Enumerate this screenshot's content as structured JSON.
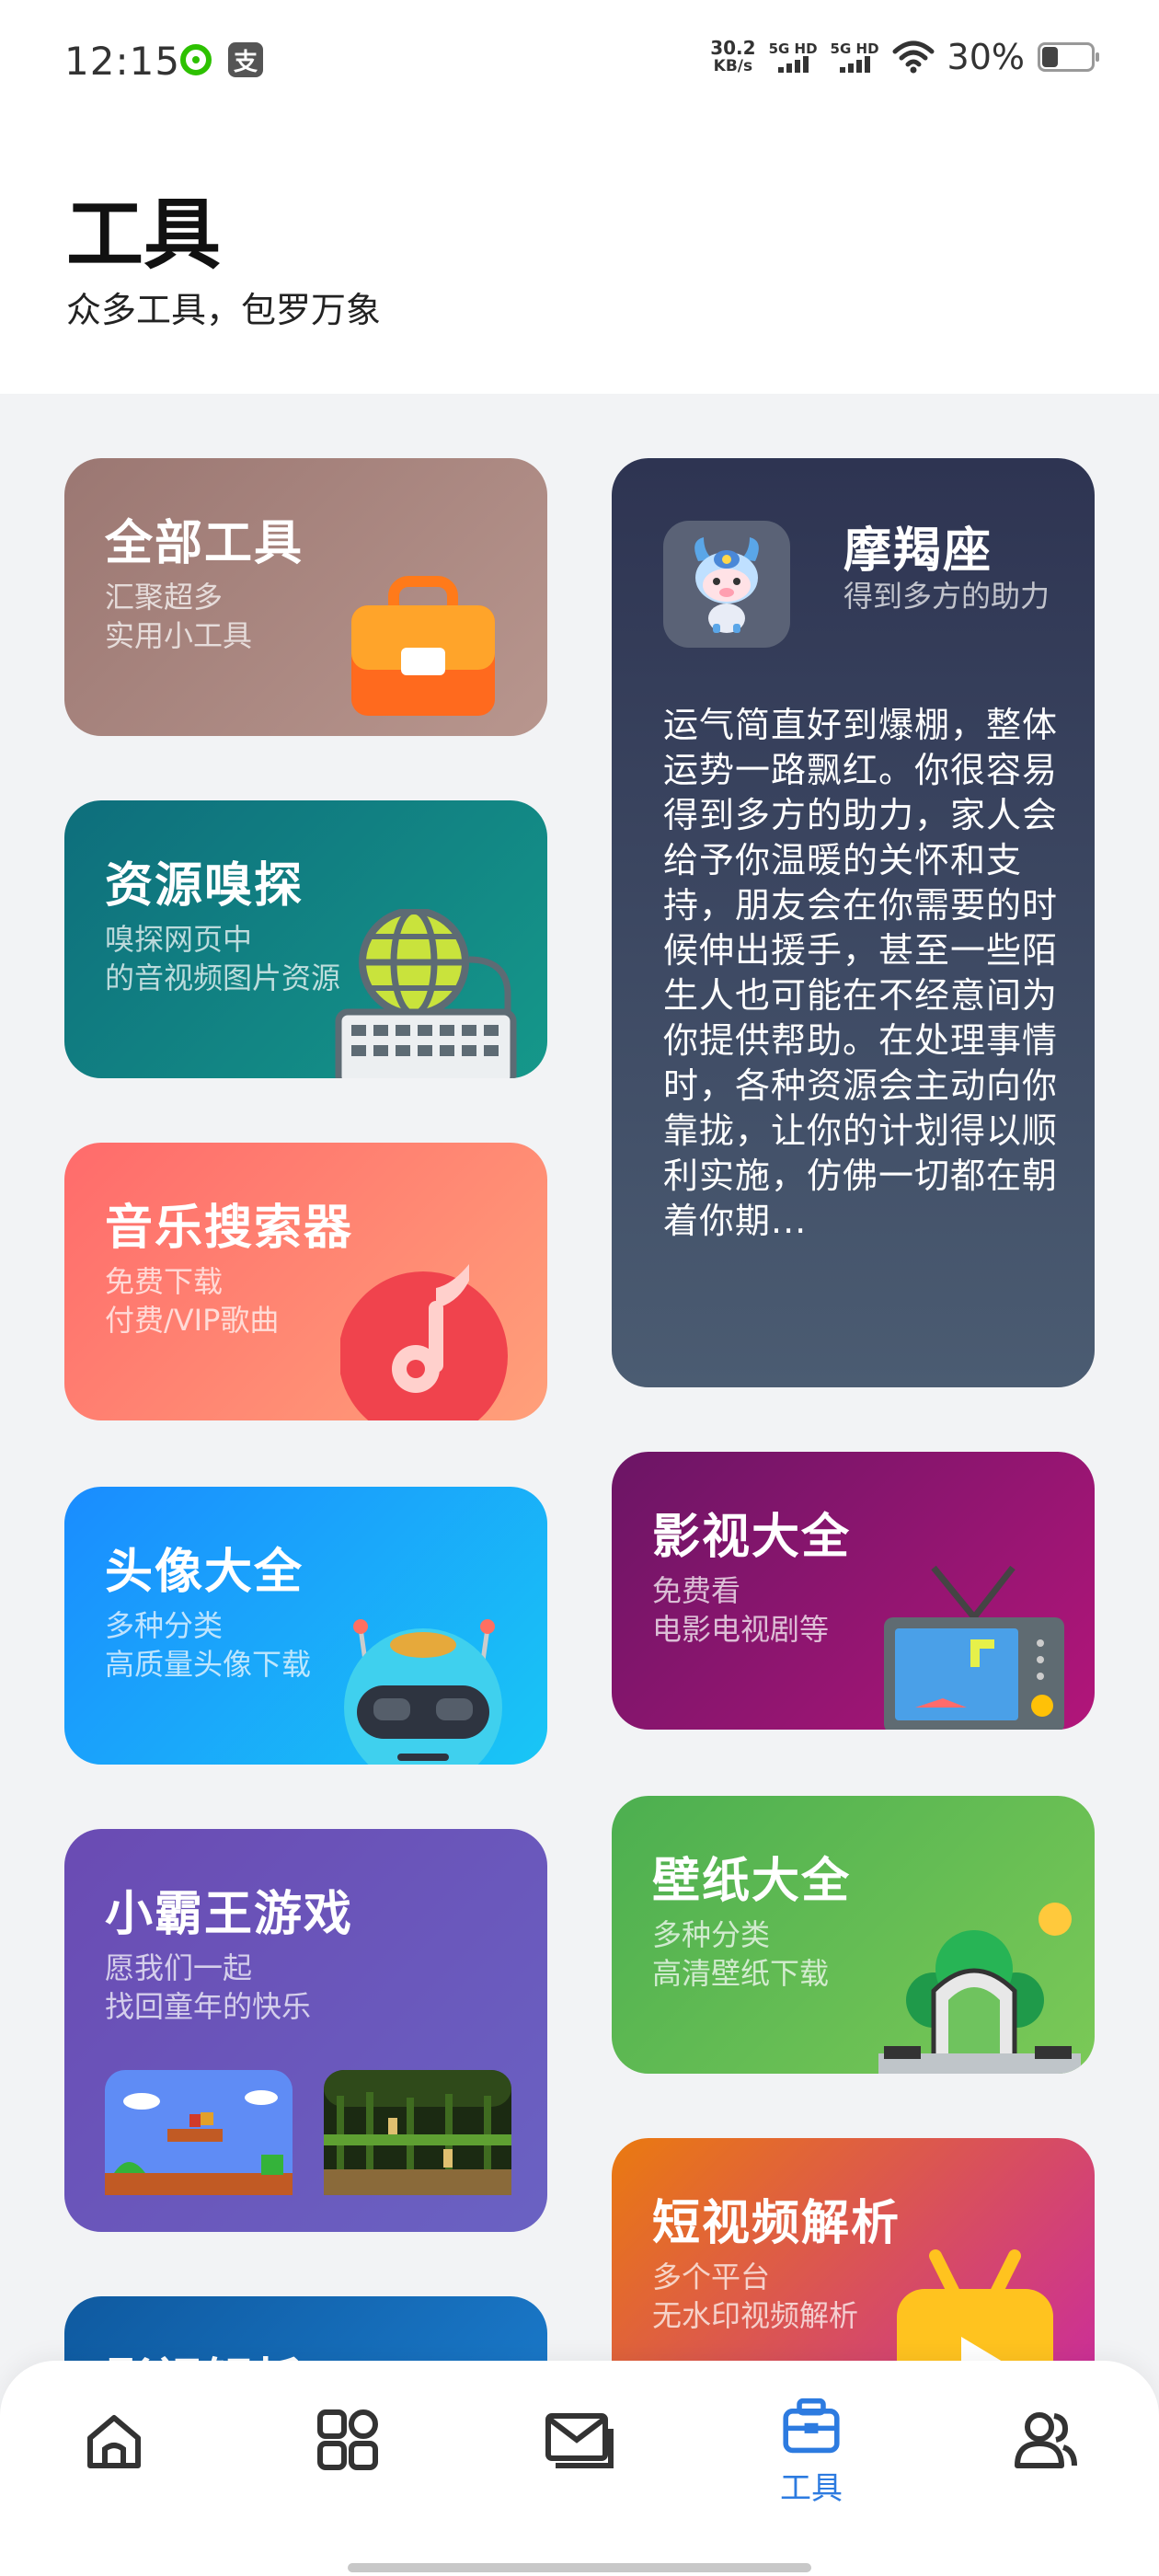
{
  "status_bar": {
    "time": "12:15",
    "net_speed_value": "30.2",
    "net_speed_unit": "KB/s",
    "sim1_label": "5G HD",
    "sim2_label": "5G HD",
    "battery_percent_text": "30%",
    "battery_level": 0.3,
    "icons": [
      "wechat-status-icon",
      "alipay-status-icon",
      "wifi-icon",
      "battery-icon"
    ]
  },
  "header": {
    "title": "工具",
    "subtitle": "众多工具，包罗万象"
  },
  "cards": {
    "all_tools": {
      "title": "全部工具",
      "desc_line1": "汇聚超多",
      "desc_line2": "实用小工具",
      "icon": "toolbox-icon"
    },
    "resource_sniff": {
      "title": "资源嗅探",
      "desc_line1": "嗅探网页中",
      "desc_line2": "的音视频图片资源",
      "icon": "globe-keyboard-icon"
    },
    "music_search": {
      "title": "音乐搜索器",
      "desc_line1": "免费下载",
      "desc_line2": "付费/VIP歌曲",
      "icon": "music-note-icon"
    },
    "avatars": {
      "title": "头像大全",
      "desc_line1": "多种分类",
      "desc_line2": "高质量头像下载",
      "icon": "robot-icon"
    },
    "nes_games": {
      "title": "小霸王游戏",
      "desc_line1": "愿我们一起",
      "desc_line2": "找回童年的快乐",
      "icon": "game-thumbnail-icon"
    },
    "video_parse": {
      "title": "影视解析"
    },
    "horoscope": {
      "sign": "摩羯座",
      "tag": "得到多方的助力",
      "text": "运气简直好到爆棚，整体运势一路飘红。你很容易得到多方的助力，家人会给予你温暖的关怀和支持，朋友会在你需要的时候伸出援手，甚至一些陌生人也可能在不经意间为你提供帮助。在处理事情时，各种资源会主动向你靠拢，让你的计划得以顺利实施，仿佛一切都在朝着你期...",
      "icon": "capricorn-mascot-icon"
    },
    "movies": {
      "title": "影视大全",
      "desc_line1": "免费看",
      "desc_line2": "电影电视剧等",
      "icon": "tv-icon"
    },
    "wallpapers": {
      "title": "壁纸大全",
      "desc_line1": "多种分类",
      "desc_line2": "高清壁纸下载",
      "icon": "landscape-icon"
    },
    "short_video": {
      "title": "短视频解析",
      "desc_line1": "多个平台",
      "desc_line2": "无水印视频解析",
      "icon": "tv-play-icon"
    }
  },
  "nav": {
    "items": [
      {
        "name": "home",
        "icon": "home-icon",
        "active": false
      },
      {
        "name": "apps",
        "icon": "grid-icon",
        "active": false
      },
      {
        "name": "messages",
        "icon": "mail-icon",
        "active": false
      },
      {
        "name": "tools",
        "icon": "toolbox-icon",
        "label": "工具",
        "active": true
      },
      {
        "name": "profile",
        "icon": "users-icon",
        "active": false
      }
    ],
    "active_color": "#2d7be0"
  },
  "colors": {
    "accent": "#2d7be0",
    "page_bg": "#f2f3f5"
  }
}
